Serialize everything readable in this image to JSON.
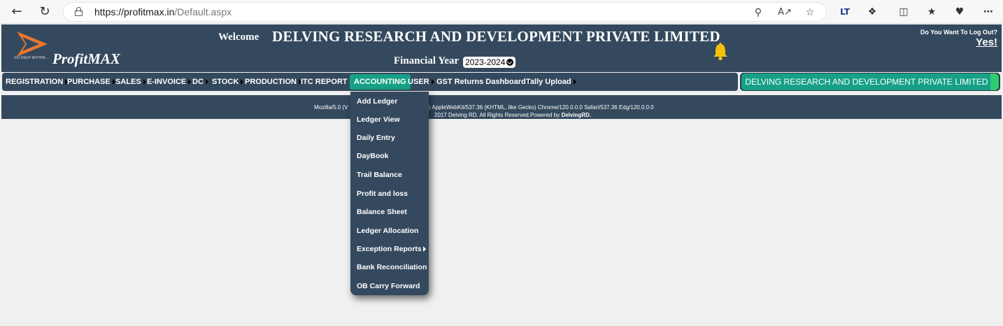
{
  "browser": {
    "url_host": "https://profitmax.in",
    "url_path": "/Default.aspx"
  },
  "header": {
    "logo_tagline": "GO DEEP WITHIN...",
    "brand": "ProfitMAX",
    "welcome": "Welcome",
    "company": "DELVING RESEARCH AND DEVELOPMENT PRIVATE LIMITED",
    "financial_year_label": "Financial Year",
    "financial_year_value": "2023-2024",
    "logout_question": "Do You Want To Log Out?",
    "logout_link": "Yes!"
  },
  "menu": {
    "items": [
      {
        "label": "REGISTRATION"
      },
      {
        "label": "PURCHASE"
      },
      {
        "label": "SALES"
      },
      {
        "label": "E-INVOICE"
      },
      {
        "label": "DC"
      },
      {
        "label": "STOCK"
      },
      {
        "label": "PRODUCTION"
      },
      {
        "label": "ITC REPORT"
      },
      {
        "label": "ACCOUNTING"
      },
      {
        "label": "USER"
      },
      {
        "label": "GST Returns Dashboard"
      },
      {
        "label": "Tally Upload"
      }
    ],
    "active": "ACCOUNTING",
    "company_pill": "DELVING RESEARCH AND DEVELOPMENT PRIVATE LIMITED"
  },
  "footer": {
    "ua_left": "Mozilla/5.0 (V",
    "ua_right": "4) AppleWebKit/537.36 (KHTML, like Gecko) Chrome/120.0.0.0 Safari/537.36 Edg/120.0.0.0",
    "copyright_right": "2017 Delving RD. All Rights Reserved.Powered by",
    "powered_by": "DelvingRD."
  },
  "accounting_dropdown": {
    "items": [
      {
        "label": "Add Ledger"
      },
      {
        "label": "Ledger View"
      },
      {
        "label": "Daily Entry"
      },
      {
        "label": "DayBook"
      },
      {
        "label": "Trail Balance"
      },
      {
        "label": "Profit and loss"
      },
      {
        "label": "Balance Sheet"
      },
      {
        "label": "Ledger Allocation"
      },
      {
        "label": "Exception Reports"
      },
      {
        "label": "Bank Reconciliation"
      },
      {
        "label": "OB Carry Forward"
      }
    ]
  },
  "colors": {
    "header_bg": "#34495e",
    "accent_teal": "#16a085",
    "bell_yellow": "#f4c20d",
    "logo_orange": "#e8772e"
  }
}
